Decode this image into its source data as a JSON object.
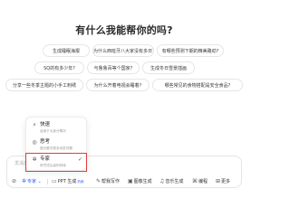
{
  "heading": "有什么我能帮你的吗?",
  "suggestions": [
    [
      "生成睡眠海报",
      "为什么西班牙八大家没有多日?",
      "有哪些预测下期的精美路劲?"
    ],
    [
      "SQ的有多少年?",
      "与鲁鲁百等个国家?",
      "生成冬日雪景插画"
    ],
    [
      "分享一些冬季主题的小手工刺绣",
      "为什么开着电视会睡着?",
      "哪些常见的食物搭配是安全食品?"
    ]
  ],
  "mode_menu": {
    "items": [
      {
        "label": "快速",
        "desc": "适用于大部分情况",
        "icon": "lightning-icon"
      },
      {
        "label": "思考",
        "desc": "擅长解决更多深层问题",
        "icon": "thinking-icon"
      },
      {
        "label": "专家",
        "desc": "研究顶尖级别领域",
        "icon": "expert-icon",
        "selected": true
      }
    ]
  },
  "input": {
    "placeholder": "发消息..."
  },
  "toolbar": {
    "attach_icon": "attach-icon",
    "expert_label": "专家",
    "ppt_label": "PPT 生成",
    "ppt_tag": "热销",
    "write_label": "帮我写作",
    "image_label": "图像生成",
    "music_label": "音乐生成",
    "code_label": "编程",
    "more_label": "更多"
  }
}
